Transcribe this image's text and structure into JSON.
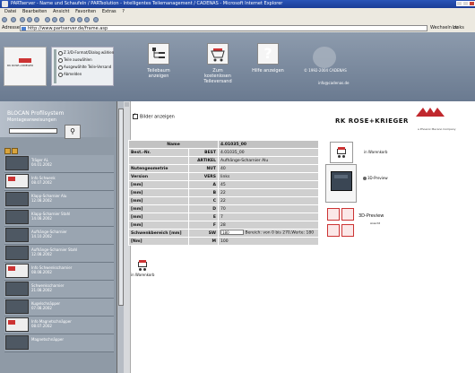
{
  "window": {
    "title": "PARTserver - Name und Schaufeln / PARTsolution - Intelligentes Teilemanagement / CADENAS - Microsoft Internet Explorer"
  },
  "menu": [
    "Datei",
    "Bearbeiten",
    "Ansicht",
    "Favoriten",
    "Extras",
    "?"
  ],
  "address": {
    "label": "Adresse",
    "url": "http://www.partserver.de/frame.asp",
    "go": "Wechseln zu",
    "links": "Links"
  },
  "header": {
    "options": [
      "Z 3/D-Format/Dialog wählen",
      "Teile auswählen",
      "Ausgewählte Teile-Versand",
      "Abmelden"
    ],
    "buttons": [
      "Teilebaum anzeigen",
      "Zum kostenlosen Teileversand",
      "Hilfe anzeigen"
    ],
    "contact_line1": "© 1992-2004 CADENAS",
    "contact_line2": "info@cadenas.de"
  },
  "left": {
    "title": "BLOCAN Profilsystem",
    "subtitle": "Montageanweisungen",
    "items": [
      {
        "name": "Träger AL",
        "date": "04.01.2002",
        "pdf": false
      },
      {
        "name": "Info Schwenk",
        "date": "08.07.2002",
        "pdf": true
      },
      {
        "name": "Klapp-Scharnier Alu",
        "date": "12.08.2002",
        "pdf": false
      },
      {
        "name": "Klapp-Scharnier Stahl",
        "date": "14.08.2002",
        "pdf": false
      },
      {
        "name": "Aufhänge-Scharnier",
        "date": "14.10.2002",
        "pdf": false
      },
      {
        "name": "Aufhänge-Scharnier Stahl",
        "date": "12.08.2002",
        "pdf": false
      },
      {
        "name": "Info Schwenkscharnier",
        "date": "08.08.2002",
        "pdf": true
      },
      {
        "name": "Schwenkscharnier",
        "date": "21.08.2002",
        "pdf": false
      },
      {
        "name": "Kugelschnäpper",
        "date": "07.08.2002",
        "pdf": false
      },
      {
        "name": "Info Magnetschnäpper",
        "date": "08.07.2002",
        "pdf": true
      },
      {
        "name": "Magnetschnäpper",
        "date": "",
        "pdf": false
      }
    ]
  },
  "main": {
    "show_images": "Bilder anzeigen",
    "brand": "RK ROSE+KRIEGER",
    "brand_tag": "a Phoenix Mecano Company",
    "table": {
      "head": [
        "Name",
        "4.01035_00"
      ],
      "rows": [
        {
          "label": "Best.-Nr.",
          "code": "BEST",
          "value": "4.01035_00"
        },
        {
          "label": "",
          "code": "ARTIKEL",
          "value": "Aufhänge-Scharnier Alu"
        },
        {
          "label": "Nutengeometrie",
          "code": "NUT",
          "value": "40"
        },
        {
          "label": "Version",
          "code": "VERS",
          "value": "links"
        },
        {
          "label": "[mm]",
          "code": "A",
          "value": "45"
        },
        {
          "label": "[mm]",
          "code": "B",
          "value": "22"
        },
        {
          "label": "[mm]",
          "code": "C",
          "value": "22"
        },
        {
          "label": "[mm]",
          "code": "D",
          "value": "70"
        },
        {
          "label": "[mm]",
          "code": "E",
          "value": "7"
        },
        {
          "label": "[mm]",
          "code": "F",
          "value": "28"
        },
        {
          "label": "Schwenkbereich [mm]",
          "code": "SW",
          "value": "180",
          "extra": "Bereich: von 0 bis 270,Werte: 180"
        },
        {
          "label": "[Nm]",
          "code": "M",
          "value": "100"
        }
      ]
    },
    "cart_label": "in Warenkorb",
    "right_cart_label": "in Warenkorb",
    "preview_label": "3D-Preview",
    "preview_a_label": "3D-Preview",
    "preview_a_sub": "Ansicht"
  }
}
